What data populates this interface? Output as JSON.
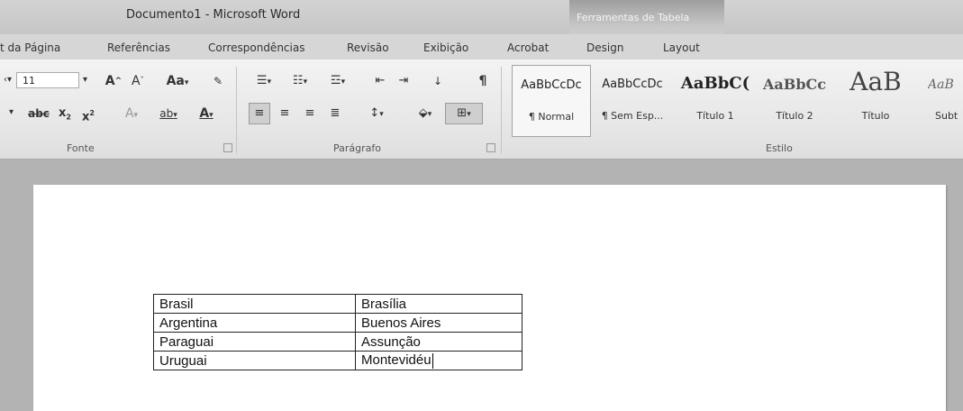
{
  "window": {
    "title": "Documento1 - Microsoft Word",
    "contextual_tab_group": "Ferramentas de Tabela"
  },
  "tabs": [
    "t da Página",
    "Referências",
    "Correspondências",
    "Revisão",
    "Exibição",
    "Acrobat",
    "Design",
    "Layout"
  ],
  "ribbon": {
    "font_size": "11",
    "group_font": "Fonte",
    "group_paragraph": "Parágrafo",
    "group_styles": "Estilo",
    "styles": [
      {
        "sample": "AaBbCcDc",
        "name": "¶ Normal",
        "selected": true
      },
      {
        "sample": "AaBbCcDc",
        "name": "¶ Sem Esp...",
        "selected": false
      },
      {
        "sample": "AaBbC(",
        "name": "Título 1",
        "selected": false
      },
      {
        "sample": "AaBbCc",
        "name": "Título 2",
        "selected": false
      },
      {
        "sample": "AaB",
        "name": "Título",
        "selected": false
      },
      {
        "sample": "AaB",
        "name": "Subt",
        "selected": false
      }
    ]
  },
  "document": {
    "table": [
      [
        "Brasil",
        "Brasília"
      ],
      [
        "Argentina",
        "Buenos Aires"
      ],
      [
        "Paraguai",
        "Assunção"
      ],
      [
        "Uruguai",
        "Montevidéu"
      ]
    ]
  }
}
